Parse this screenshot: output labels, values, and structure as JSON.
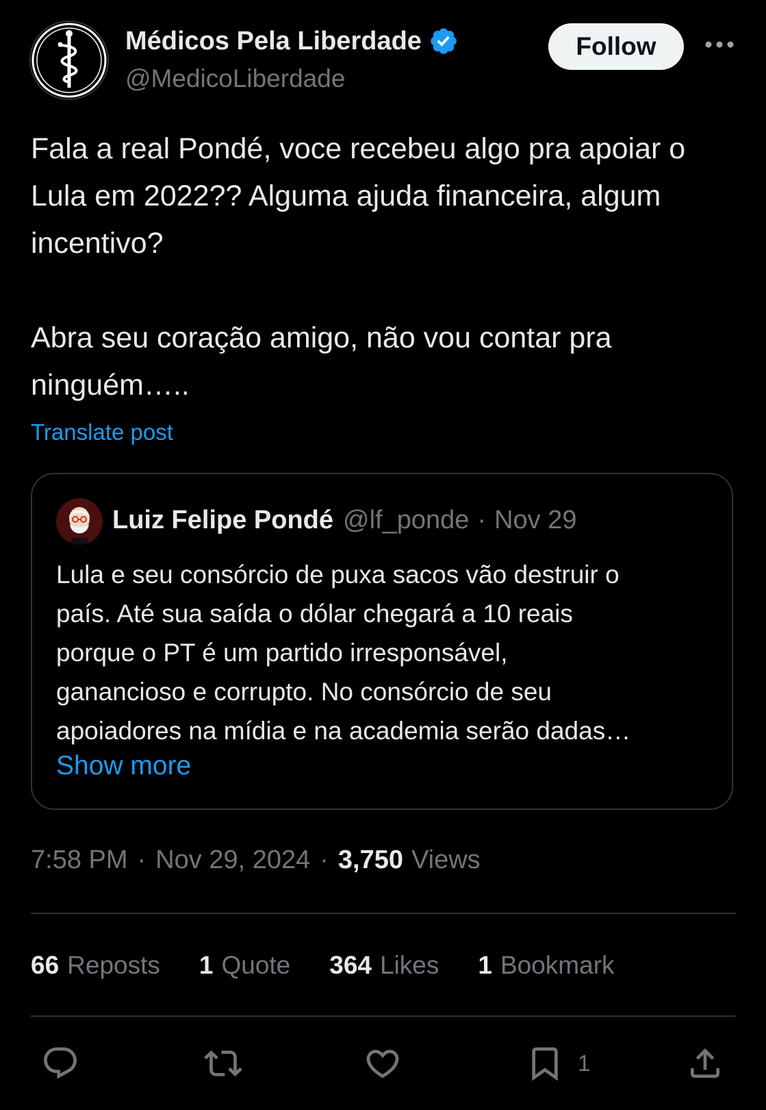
{
  "author": {
    "name": "Médicos Pela Liberdade",
    "handle": "@MedicoLiberdade",
    "verified": true
  },
  "header": {
    "follow_label": "Follow"
  },
  "post": {
    "text": "Fala a real Pondé, voce recebeu algo pra apoiar o Lula em 2022??  Alguma ajuda financeira, algum incentivo?\n\nAbra seu coração amigo, não vou contar pra ninguém…..",
    "translate_label": "Translate post"
  },
  "quote": {
    "author_name": "Luiz Felipe Pondé",
    "author_handle": "@lf_ponde",
    "separator": "·",
    "date": "Nov 29",
    "text_lines": [
      "Lula e seu consórcio de puxa sacos vão destruir o",
      "país. Até sua saída o dólar chegará a 10 reais",
      "porque o PT é um partido irresponsável,",
      "ganancioso e corrupto. No consórcio de seu",
      "apoiadores na mídia e na academia serão dadas…"
    ],
    "show_more_label": "Show more"
  },
  "meta": {
    "time": "7:58 PM",
    "separator": "·",
    "date": "Nov 29, 2024",
    "views_count": "3,750",
    "views_label": "Views"
  },
  "stats": {
    "reposts": {
      "count": "66",
      "label": "Reposts"
    },
    "quotes": {
      "count": "1",
      "label": "Quote"
    },
    "likes": {
      "count": "364",
      "label": "Likes"
    },
    "bookmarks": {
      "count": "1",
      "label": "Bookmark"
    }
  },
  "actions": {
    "reply_icon": "reply-icon",
    "repost_icon": "repost-icon",
    "like_icon": "heart-icon",
    "bookmark_icon": "bookmark-icon",
    "bookmark_count": "1",
    "share_icon": "share-icon"
  },
  "colors": {
    "background": "#000000",
    "text": "#e7e9ea",
    "muted": "#71767b",
    "accent": "#1d9bf0",
    "border": "#2f3336"
  }
}
